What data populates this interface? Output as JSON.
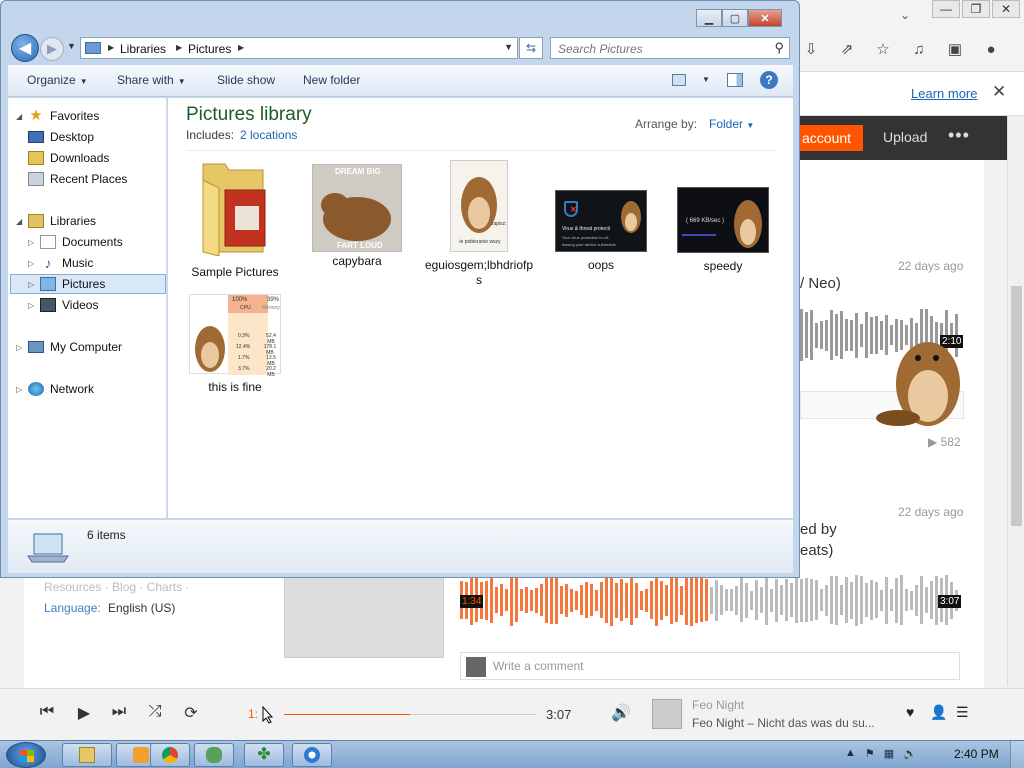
{
  "browser": {
    "learn_more": "Learn more",
    "sc": {
      "account": "account",
      "upload": "Upload",
      "more": "•••"
    },
    "feed": {
      "track1": {
        "age": "22 days ago",
        "title": "/ Neo)",
        "time": "2:10",
        "plays": "582"
      },
      "track2": {
        "age": "22 days ago",
        "title_line1": "ed by",
        "title_line2": "eats)",
        "cur_time": "1:34",
        "end_time": "3:07",
        "played_fraction": 0.5
      },
      "footer_links": "Resources · Blog · Charts ·",
      "language_label": "Language:",
      "language_value": "English (US)",
      "comment_placeholder": "Write a comment"
    },
    "player": {
      "cur_time": "1:",
      "end_time": "3:07",
      "progress_fraction": 0.5,
      "artist": "Feo Night",
      "title": "Feo Night – Nicht das was du su..."
    }
  },
  "explorer": {
    "breadcrumb": [
      "Libraries",
      "Pictures"
    ],
    "search_placeholder": "Search Pictures",
    "commands": {
      "organize": "Organize",
      "share": "Share with",
      "slideshow": "Slide show",
      "new_folder": "New folder"
    },
    "nav": {
      "favorites": "Favorites",
      "desktop": "Desktop",
      "downloads": "Downloads",
      "recent": "Recent Places",
      "libraries": "Libraries",
      "documents": "Documents",
      "music": "Music",
      "pictures": "Pictures",
      "videos": "Videos",
      "computer": "My Computer",
      "network": "Network"
    },
    "library": {
      "title": "Pictures library",
      "includes_label": "Includes:",
      "includes_value": "2 locations",
      "arrange_label": "Arrange by:",
      "arrange_value": "Folder"
    },
    "items": [
      {
        "name": "Sample Pictures"
      },
      {
        "name": "capybara"
      },
      {
        "name": "eguiosgem;lbhdriofps"
      },
      {
        "name": "oops"
      },
      {
        "name": "speedy"
      },
      {
        "name": "this is fine"
      }
    ],
    "thumb_text": {
      "capybara_top": "DREAM BIG",
      "capybara_bottom": "FART LOUD",
      "egui_side": "zapisz: jy",
      "egui_bottom": "ie pobieranie wszy",
      "oops_line1": "Virus & threat protecti",
      "oops_line2": "Your virus protection is off,",
      "oops_line3": "leaving your device vulnerable.",
      "speedy_label": "( 669 KB/sec )",
      "fine_cpu_pct": "100%",
      "fine_cpu": "CPU",
      "fine_mem_pct": "39%",
      "fine_mem": "Memory",
      "fine_rows": [
        {
          "cpu": "0.3%",
          "mem": "52.4 MB"
        },
        {
          "cpu": "12.4%",
          "mem": "178.1 MB"
        },
        {
          "cpu": "1.7%",
          "mem": "13.5 MB"
        },
        {
          "cpu": "3.7%",
          "mem": "20.2 MB"
        }
      ]
    },
    "status": "6 items"
  },
  "taskbar": {
    "time": "2:40 PM"
  }
}
